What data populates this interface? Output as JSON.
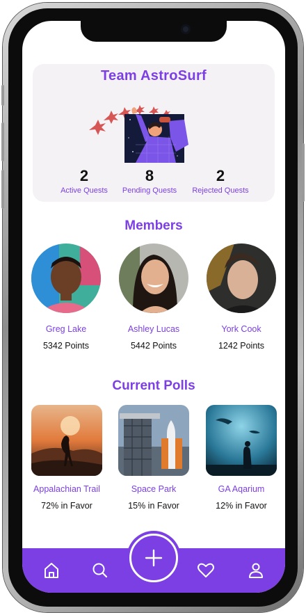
{
  "team": {
    "name": "Team AstroSurf",
    "stats": [
      {
        "value": "2",
        "label": "Active Quests"
      },
      {
        "value": "8",
        "label": "Pending Quests"
      },
      {
        "value": "2",
        "label": "Rejected Quests"
      }
    ]
  },
  "members": {
    "title": "Members",
    "items": [
      {
        "name": "Greg Lake",
        "points": "5342 Points"
      },
      {
        "name": "Ashley Lucas",
        "points": "5442 Points"
      },
      {
        "name": "York Cook",
        "points": "1242 Points"
      }
    ]
  },
  "polls": {
    "title": "Current Polls",
    "items": [
      {
        "name": "Appalachian Trail",
        "favor": "72% in Favor"
      },
      {
        "name": "Space Park",
        "favor": "15% in Favor"
      },
      {
        "name": "GA Aqarium",
        "favor": "12% in Favor"
      }
    ]
  },
  "nav": {
    "items": [
      "home-icon",
      "search-icon",
      "plus-icon",
      "heart-icon",
      "user-icon"
    ]
  },
  "colors": {
    "accent": "#7b3fe4",
    "card_bg": "#f4f2f5",
    "text": "#111111"
  }
}
